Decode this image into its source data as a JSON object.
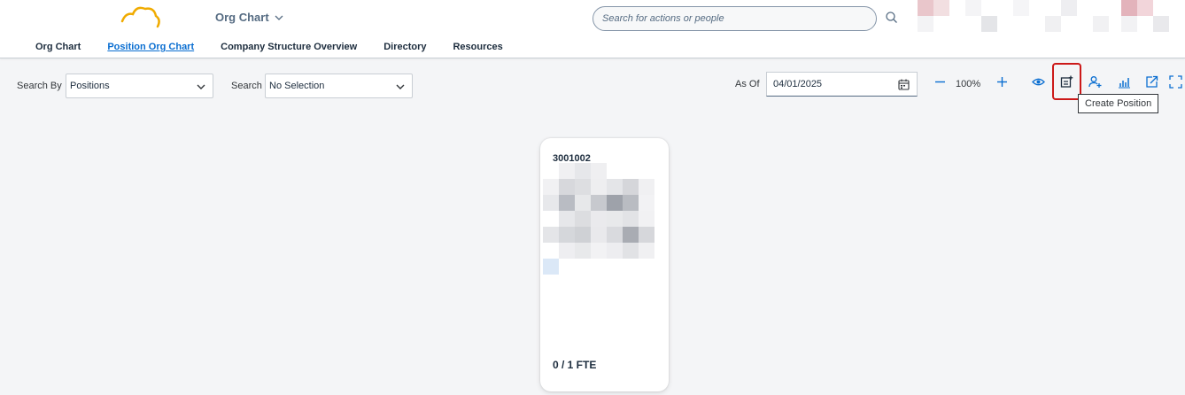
{
  "header": {
    "app_title": "Org Chart",
    "search_placeholder": "Search for actions or people",
    "tabs": [
      {
        "label": "Org Chart",
        "active": false
      },
      {
        "label": "Position Org Chart",
        "active": true
      },
      {
        "label": "Company Structure Overview",
        "active": false
      },
      {
        "label": "Directory",
        "active": false
      },
      {
        "label": "Resources",
        "active": false
      }
    ]
  },
  "toolbar": {
    "search_by_label": "Search By",
    "search_by_value": "Positions",
    "search_label": "Search",
    "search_value": "No Selection",
    "as_of_label": "As Of",
    "as_of_value": "04/01/2025",
    "zoom_value": "100%",
    "tooltip": "Create Position",
    "icons": [
      "zoom-out-icon",
      "zoom-in-icon",
      "view-icon",
      "create-position-icon",
      "add-person-icon",
      "chart-icon",
      "export-icon",
      "fullscreen-icon"
    ]
  },
  "card": {
    "position_id": "3001002",
    "fte": "0 / 1 FTE"
  },
  "colors": {
    "brand_blue": "#0a6ed1",
    "logo_gold": "#f0ab00",
    "highlight_red": "#cc1919",
    "background": "#f4f5f7"
  }
}
